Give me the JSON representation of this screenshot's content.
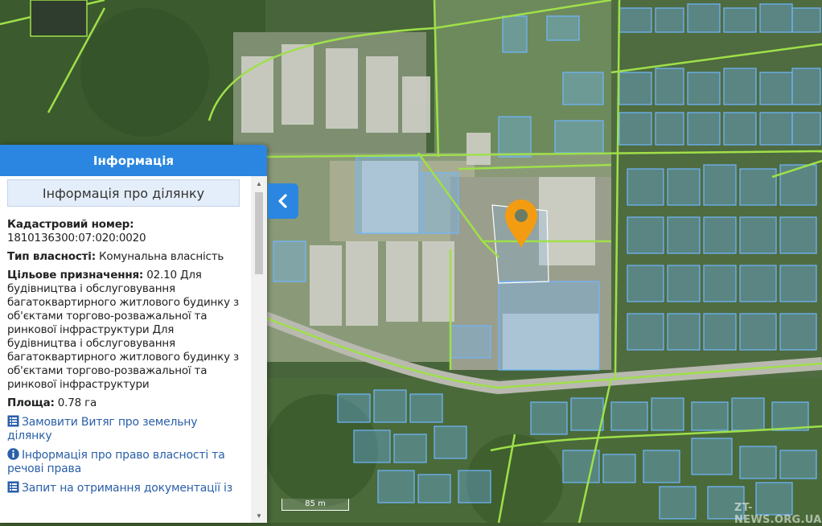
{
  "panel": {
    "header": "Інформація",
    "section_title": "Інформація про ділянку",
    "cadastral_label": "Кадастровий номер:",
    "cadastral_value": "1810136300:07:020:0020",
    "ownership_label": "Тип власності:",
    "ownership_value": "Комунальна власність",
    "purpose_label": "Цільове призначення:",
    "purpose_value": "02.10 Для будівництва і обслуговування багатоквартирного житлового будинку з об'єктами торгово-розважальної та ринкової інфраструктури Для будівництва і обслуговування багатоквартирного житлового будинку з об'єктами торгово-розважальної та ринкової інфраструктури",
    "area_label": "Площа:",
    "area_value": "0.78 га",
    "links": [
      {
        "icon": "list-icon",
        "label": "Замовити Витяг про земельну ділянку"
      },
      {
        "icon": "info-icon",
        "label": "Інформація про право власності та речові права"
      },
      {
        "icon": "list-icon",
        "label": "Запит на отримання документації із"
      }
    ]
  },
  "map": {
    "scale_label": "85 m",
    "watermark": "ZT-NEWS.ORG.UA",
    "marker_color": "#f39c12",
    "parcel_color": "#6fb7ff",
    "road_color": "#9fe04a"
  }
}
